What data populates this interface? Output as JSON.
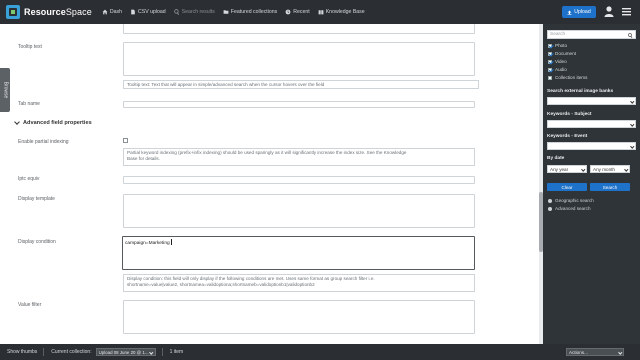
{
  "header": {
    "logo_icon": "resourcespace-logo-icon",
    "logo_bold": "Resource",
    "logo_light": "Space",
    "nav": [
      {
        "label": "Dash",
        "icon": "home-icon"
      },
      {
        "label": "CSV upload",
        "icon": "csv-upload-icon"
      },
      {
        "label": "Search results",
        "icon": "search-icon"
      },
      {
        "label": "Featured collections",
        "icon": "folder-icon"
      },
      {
        "label": "Recent",
        "icon": "clock-icon"
      },
      {
        "label": "Knowledge Base",
        "icon": "book-icon"
      }
    ],
    "upload_label": "Upload",
    "accent": "#1f72c9"
  },
  "sidebar_tab": {
    "label": "Browse"
  },
  "form": {
    "tooltip_label": "Tooltip text",
    "tooltip_help": "Tooltip text: Text that will appear in simple/advanced search when the cursor hovers over the field",
    "tab_name_label": "Tab name",
    "advanced_title": "Advanced field properties",
    "partial_index_label": "Enable partial indexing",
    "partial_index_help_1": "Partial keyword indexing (prefix+infix indexing) should be used sparingly as it will significantly increase the index size. See the Knowledge",
    "partial_index_help_2": "Base for details.",
    "iptc_label": "Iptc equiv",
    "display_template_label": "Display template",
    "display_condition_label": "Display condition",
    "display_condition_value": "campaign=Marketing",
    "display_condition_help_1": "Display condition: this field will only display if the following conditions are met. Uses same format as group search filter i.e.",
    "display_condition_help_2": "shortname=value|value2, shortnamea=validoptiona;shortnameb=validoptionb1|validoptionb2",
    "value_filter_label": "Value filter"
  },
  "panel": {
    "search_placeholder": "Search",
    "resource_types": [
      {
        "label": "Photo",
        "checked": true
      },
      {
        "label": "Document",
        "checked": true
      },
      {
        "label": "Video",
        "checked": true
      },
      {
        "label": "Audio",
        "checked": true
      },
      {
        "label": "Collection items",
        "checked": false
      }
    ],
    "external_label": "Search external image banks",
    "keywords_subject": "Keywords - Subject",
    "keywords_event": "Keywords - Event",
    "by_date": "By date",
    "any_year": "Any year",
    "any_month": "Any month",
    "clear_label": "Clear",
    "search_label": "Search",
    "geographic_search": "Geographic search",
    "advanced_search": "Advanced search"
  },
  "footer": {
    "show_thumbs": "Show thumbs",
    "current_collection": "Current collection:",
    "collection_value": "Upload 08 June 20 @ 1...",
    "item_count": "1 item",
    "actions": "Actions..."
  }
}
